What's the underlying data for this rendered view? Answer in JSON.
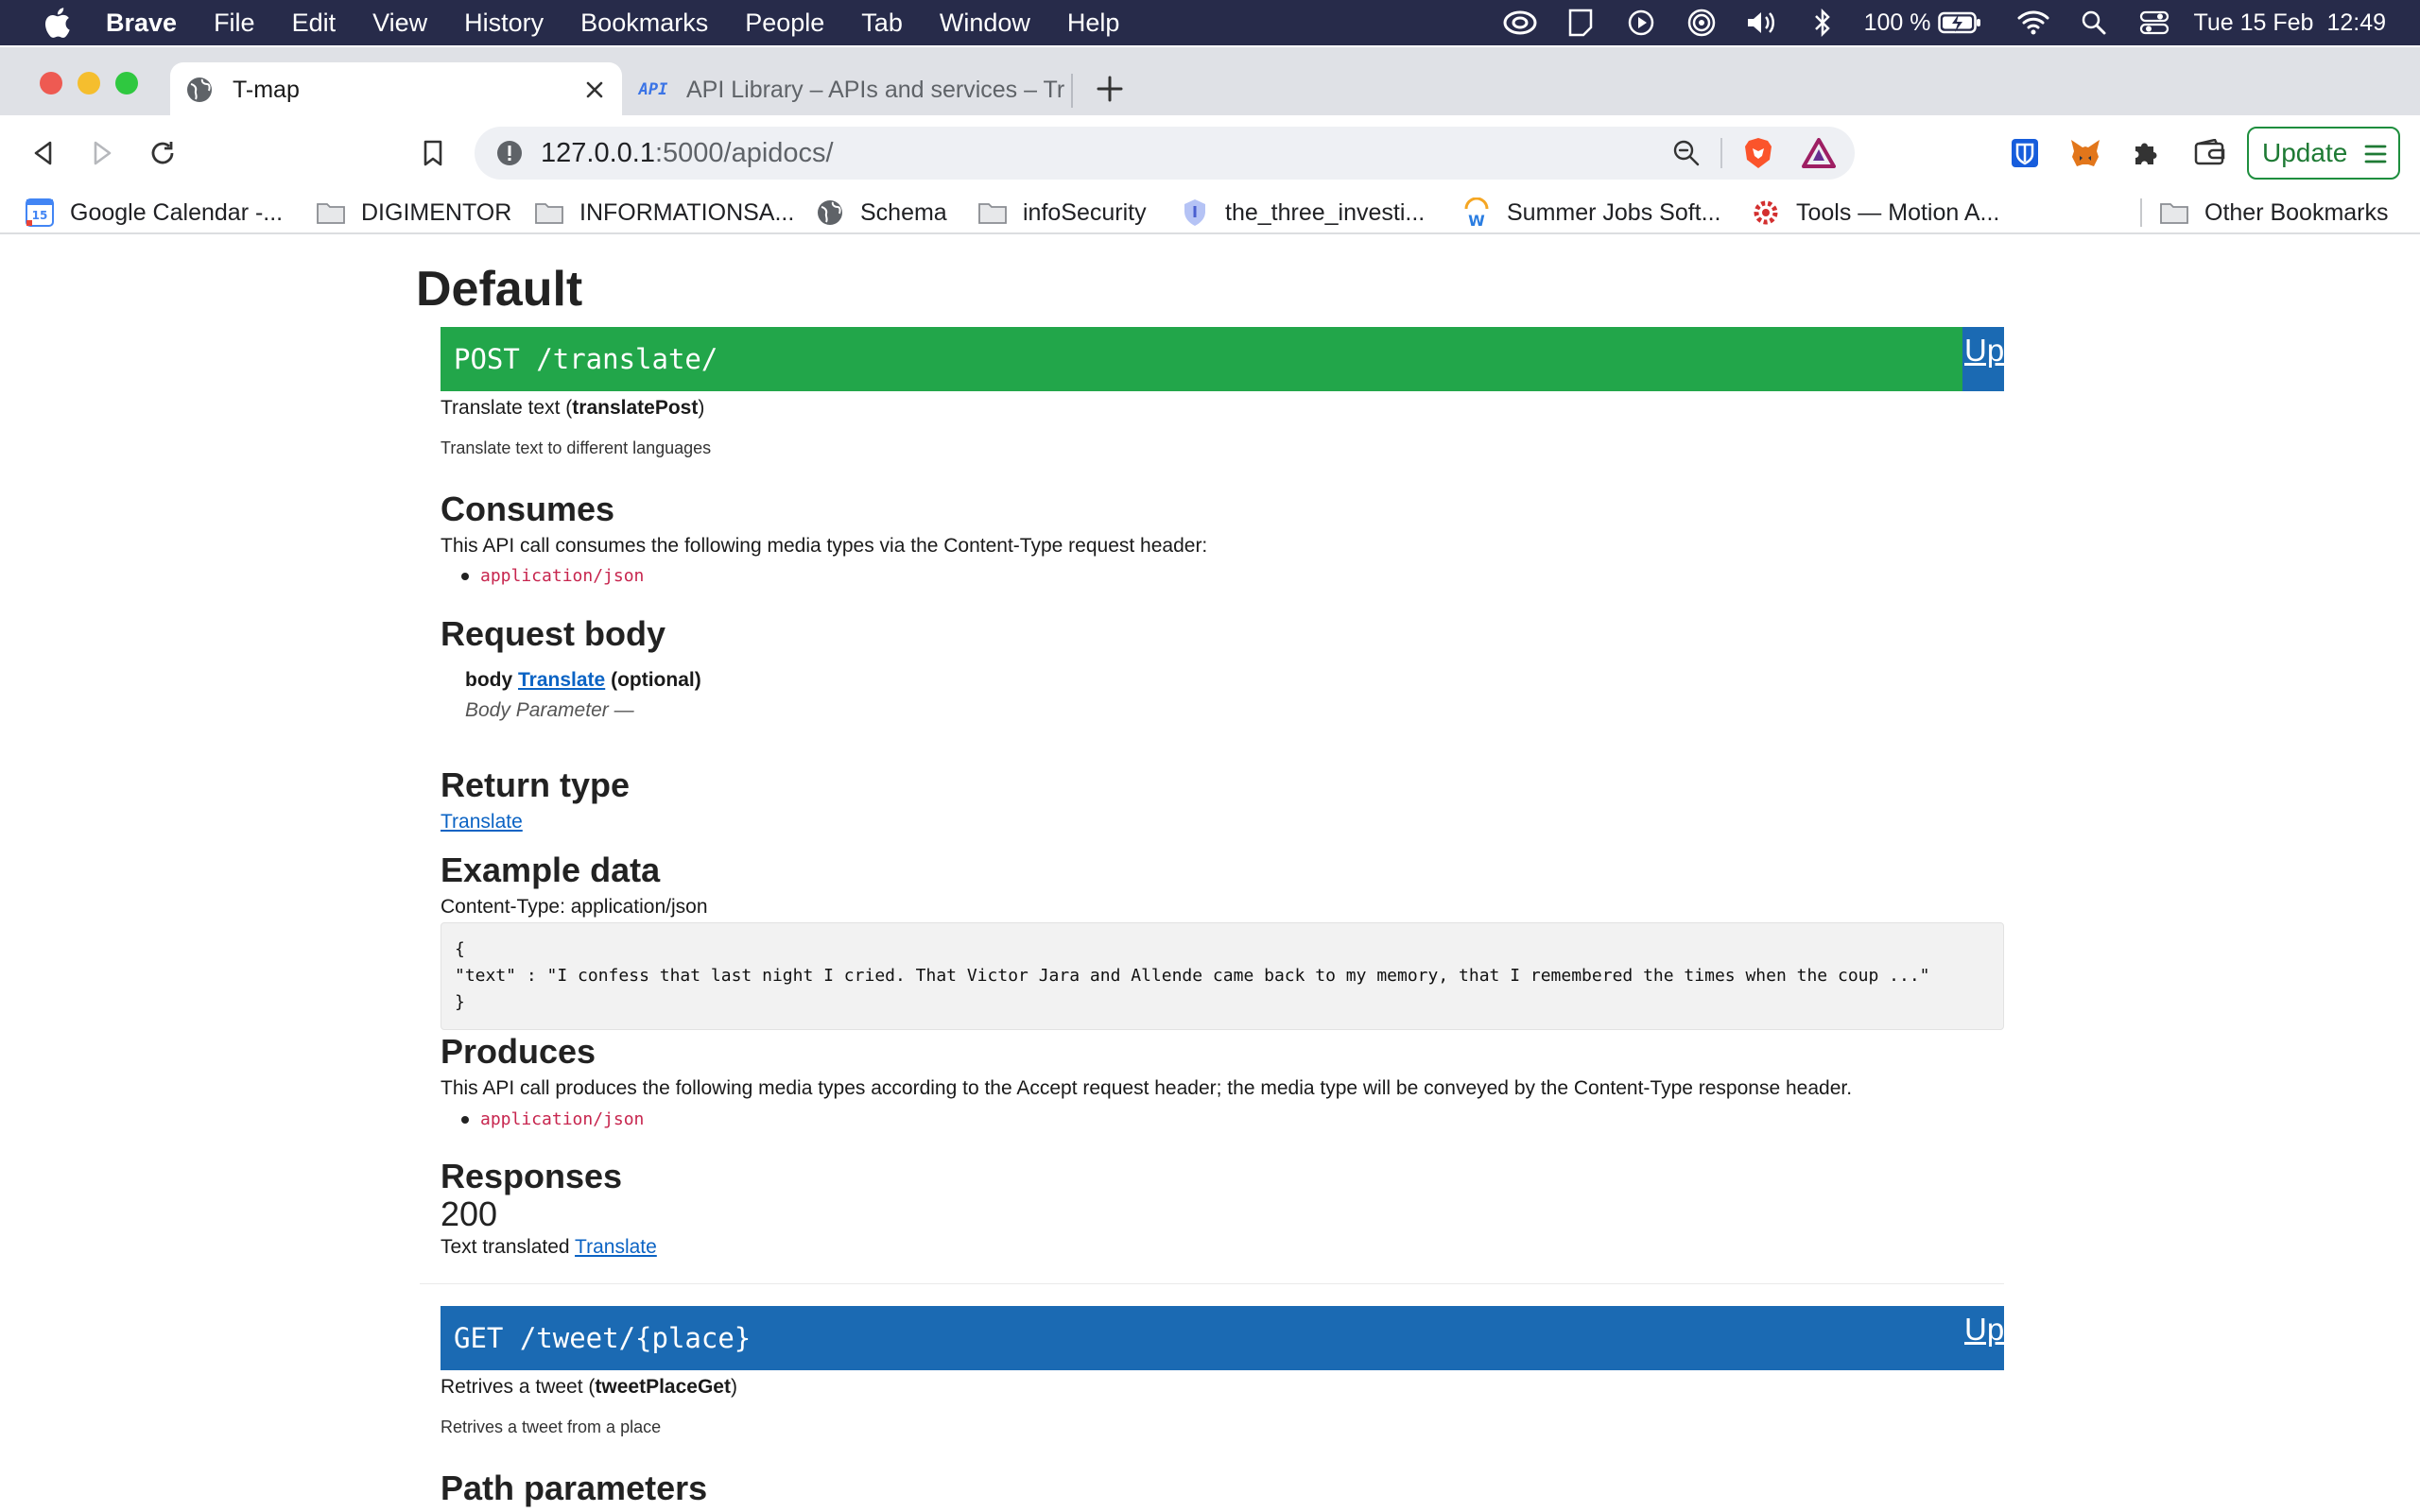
{
  "menubar": {
    "app": "Brave",
    "items": [
      "File",
      "Edit",
      "View",
      "History",
      "Bookmarks",
      "People",
      "Tab",
      "Window",
      "Help"
    ],
    "battery": "100 %",
    "date": "Tue 15 Feb",
    "time": "12:49"
  },
  "tabs": [
    {
      "title": "T-map",
      "favicon": "globe-icon",
      "active": true
    },
    {
      "title": "API Library – APIs and services – Tr",
      "favicon": "api-icon",
      "favicon_text": "API",
      "active": false
    }
  ],
  "toolbar": {
    "url_host": "127.0.0.1",
    "url_path": ":5000/apidocs/",
    "update_label": "Update"
  },
  "bookmarks": [
    {
      "label": "Google Calendar -...",
      "icon": "calendar-icon",
      "icon_text": "15"
    },
    {
      "label": "DIGIMENTOR",
      "icon": "folder-icon"
    },
    {
      "label": "INFORMATIONSA...",
      "icon": "folder-icon"
    },
    {
      "label": "Schema",
      "icon": "globe-icon"
    },
    {
      "label": "infoSecurity",
      "icon": "folder-icon"
    },
    {
      "label": "the_three_investi...",
      "icon": "shield-icon"
    },
    {
      "label": "Summer Jobs Soft...",
      "icon": "w-icon",
      "icon_text": "W"
    },
    {
      "label": "Tools — Motion A...",
      "icon": "gear-icon"
    },
    {
      "label": "Other Bookmarks",
      "icon": "folder-icon"
    }
  ],
  "page": {
    "heading": "Default",
    "endpoint1": {
      "method_path": "POST /translate/",
      "up": "Up",
      "summary_prefix": "Translate text (",
      "operation_id": "translatePost",
      "summary_suffix": ")",
      "description": "Translate text to different languages",
      "consumes_title": "Consumes",
      "consumes_text": "This API call consumes the following media types via the Content-Type request header:",
      "consumes_media": "application/json",
      "request_body_title": "Request body",
      "body_label": "body",
      "body_link": "Translate",
      "body_optional": "(optional)",
      "body_param": "Body Parameter —",
      "return_type_title": "Return type",
      "return_type_link": "Translate",
      "example_title": "Example data",
      "example_content_type": "Content-Type: application/json",
      "example_lines": [
        "{",
        "\"text\" : \"I confess that last night I cried. That Victor Jara and Allende came back to my memory, that I remembered the times when the coup ...\"",
        "}"
      ],
      "produces_title": "Produces",
      "produces_text": "This API call produces the following media types according to the Accept request header; the media type will be conveyed by the Content-Type response header.",
      "produces_media": "application/json",
      "responses_title": "Responses",
      "response_code": "200",
      "response_text": "Text translated",
      "response_link": "Translate"
    },
    "endpoint2": {
      "method_path": "GET /tweet/{place}",
      "up": "Up",
      "summary_prefix": "Retrives a tweet (",
      "operation_id": "tweetPlaceGet",
      "summary_suffix": ")",
      "description": "Retrives a tweet from a place",
      "path_params_title": "Path parameters"
    }
  },
  "colors": {
    "post": "#22a64a",
    "get": "#1b6ab3",
    "menubar": "#272b4a",
    "code_pink": "#c7254e",
    "link": "#0b63c4"
  }
}
